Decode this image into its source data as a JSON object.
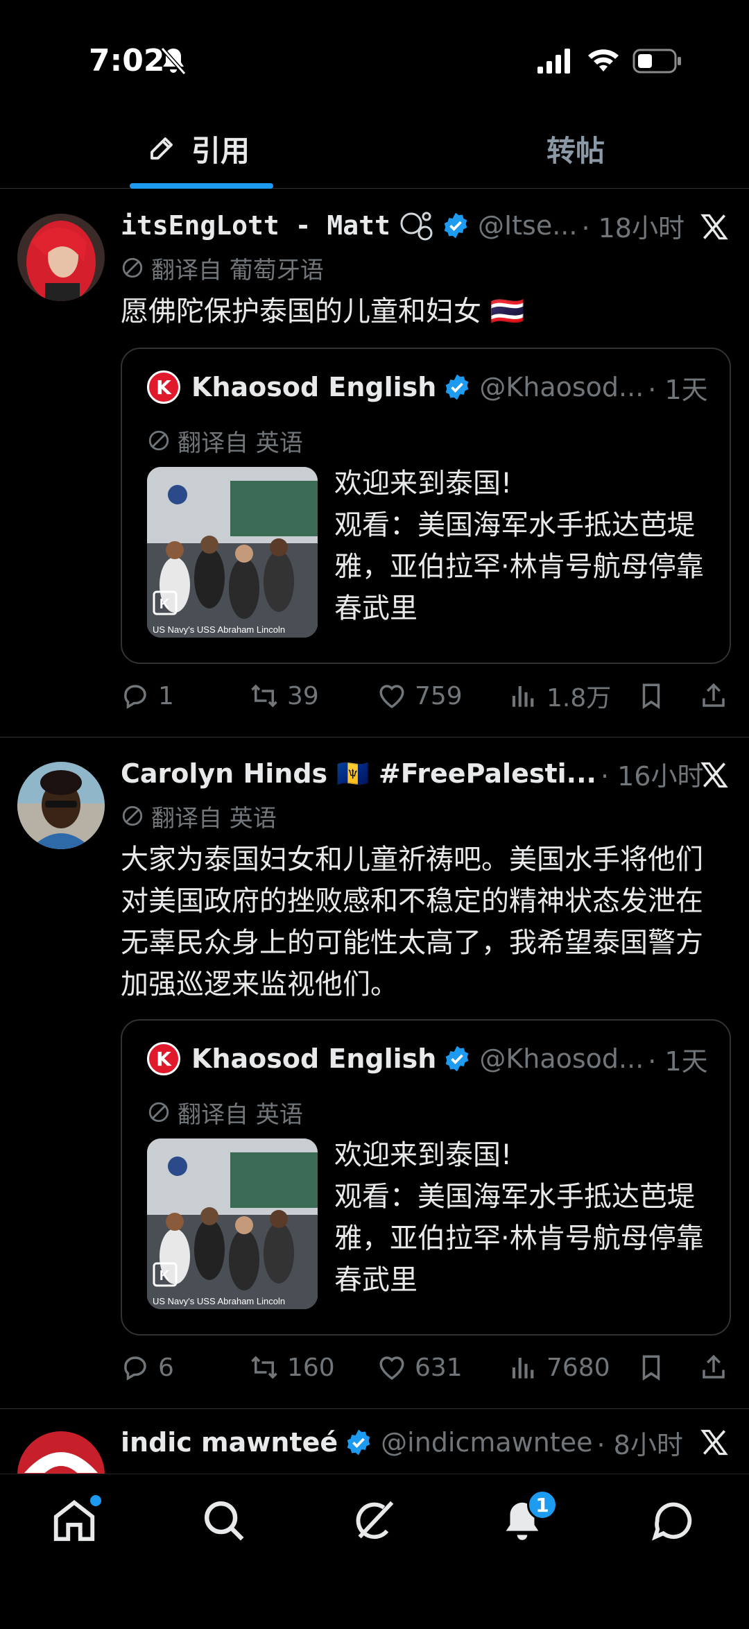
{
  "status_bar": {
    "time": "7:02"
  },
  "tabs": [
    {
      "label": "引用"
    },
    {
      "label": "转帖"
    }
  ],
  "posts": [
    {
      "display_name": "itsEngLott - Matt",
      "handle": "@Itse...",
      "timestamp": "· 18小时",
      "translated_label": "翻译自 葡萄牙语",
      "text": "愿佛陀保护泰国的儿童和妇女 🇹🇭",
      "quote": {
        "display_name": "Khaosod English",
        "handle": "@Khaosod...",
        "timestamp": "· 1天",
        "translated_label": "翻译自 英语",
        "thumb_caption": "US Navy's USS Abraham Lincoln",
        "text": "欢迎来到泰国!\n观看：美国海军水手抵达芭堤雅，亚伯拉罕·林肯号航母停靠春武里"
      },
      "stats": {
        "replies": "1",
        "reposts": "39",
        "likes": "759",
        "views": "1.8万"
      }
    },
    {
      "display_name": "Carolyn Hinds 🇧🇧 #FreePalesti...",
      "handle": "",
      "timestamp": "· 16小时",
      "translated_label": "翻译自 英语",
      "text": "大家为泰国妇女和儿童祈祷吧。美国水手将他们对美国政府的挫败感和不稳定的精神状态发泄在无辜民众身上的可能性太高了，我希望泰国警方加强巡逻来监视他们。",
      "quote": {
        "display_name": "Khaosod English",
        "handle": "@Khaosod...",
        "timestamp": "· 1天",
        "translated_label": "翻译自 英语",
        "thumb_caption": "US Navy's USS Abraham Lincoln",
        "text": "欢迎来到泰国!\n观看：美国海军水手抵达芭堤雅，亚伯拉罕·林肯号航母停靠春武里"
      },
      "stats": {
        "replies": "6",
        "reposts": "160",
        "likes": "631",
        "views": "7680"
      }
    },
    {
      "display_name": "indic mawnteé",
      "handle": "@indicmawntee",
      "timestamp": "· 8小时"
    }
  ],
  "bottom_nav": {
    "notifications_badge": "1"
  },
  "colors": {
    "accent": "#1d9bf0",
    "muted": "#71767b",
    "border": "#2f3336",
    "khaosod_red": "#e0192d"
  }
}
